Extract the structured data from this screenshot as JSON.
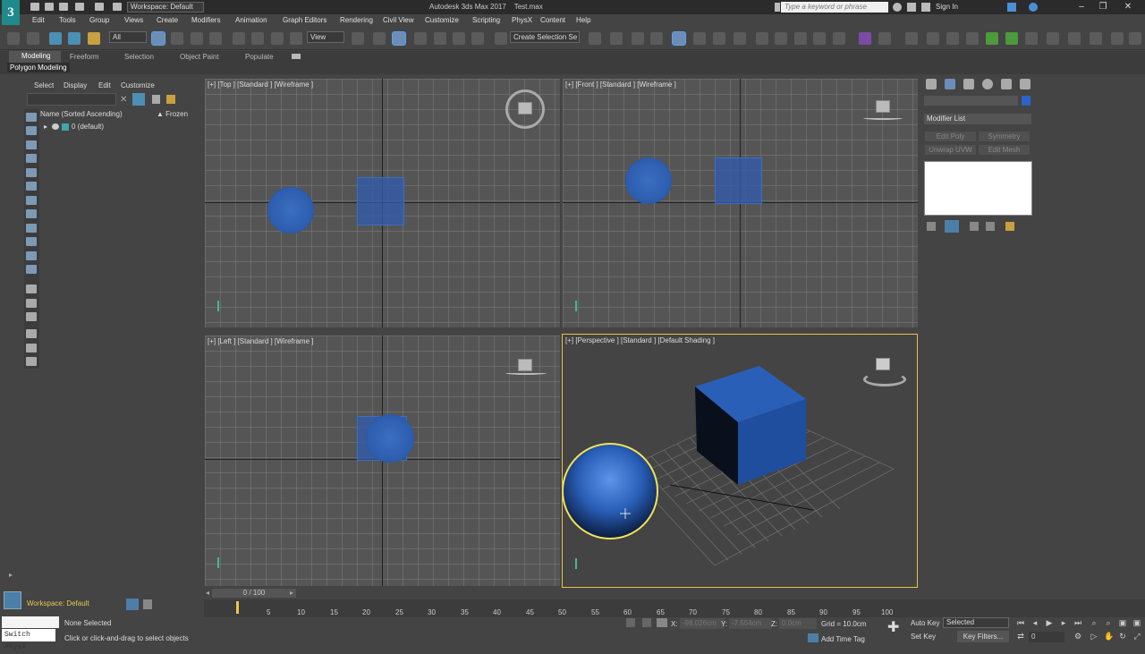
{
  "title_bar": {
    "app_icon": "3",
    "workspace": "Workspace: Default",
    "title": "Autodesk 3ds Max 2017",
    "filename": "Test.max",
    "search_placeholder": "Type a keyword or phrase",
    "sign_in": "Sign In"
  },
  "menu": [
    "Edit",
    "Tools",
    "Group",
    "Views",
    "Create",
    "Modifiers",
    "Animation",
    "Graph Editors",
    "Rendering",
    "Civil View",
    "Customize",
    "Scripting",
    "PhysX",
    "Content",
    "Help"
  ],
  "toolbar": {
    "filter": "All",
    "ref_coord": "View",
    "selection_set": "Create Selection Se"
  },
  "ribbon": {
    "tabs": [
      "Modeling",
      "Freeform",
      "Selection",
      "Object Paint",
      "Populate"
    ],
    "sub": "Polygon Modeling"
  },
  "explorer": {
    "menu": [
      "Select",
      "Display",
      "Edit",
      "Customize"
    ],
    "col_name": "Name (Sorted Ascending)",
    "col_frozen": "▲ Frozen",
    "row": "0 (default)"
  },
  "viewports": {
    "top": "[+] [Top ] [Standard ] [Wireframe ]",
    "front": "[+] [Front ] [Standard ] [Wireframe ]",
    "left": "[+] [Left ] [Standard ] [Wireframe ]",
    "persp": "[+] [Perspective ] [Standard ] [Default Shading ]"
  },
  "command_panel": {
    "modifier_list": "Modifier List",
    "buttons": [
      "Edit Poly",
      "Symmetry",
      "Unwrap UVW",
      "Edit Mesh"
    ]
  },
  "timeline": {
    "slider": "0 / 100",
    "ticks": [
      "5",
      "10",
      "15",
      "20",
      "25",
      "30",
      "35",
      "40",
      "45",
      "50",
      "55",
      "60",
      "65",
      "70",
      "75",
      "80",
      "85",
      "90",
      "95",
      "100"
    ]
  },
  "status": {
    "workspace": "Workspace: Default",
    "line1": "None Selected",
    "line2": "Click or click-and-drag to select objects",
    "switch": "Switch PhysX",
    "x_label": "X:",
    "x_val": "-98.026cm",
    "y_label": "Y:",
    "y_val": "-7.554cm",
    "z_label": "Z:",
    "z_val": "0.0cm",
    "grid": "Grid = 10.0cm",
    "add_time_tag": "Add Time Tag",
    "auto_key": "Auto Key",
    "set_key": "Set Key",
    "selected": "Selected",
    "key_filters": "Key Filters...",
    "frame": "0"
  },
  "colors": {
    "object_blue": "#2a64c8",
    "selection_yellow": "#f2e35a",
    "active_viewport_border": "#e8c24a"
  }
}
